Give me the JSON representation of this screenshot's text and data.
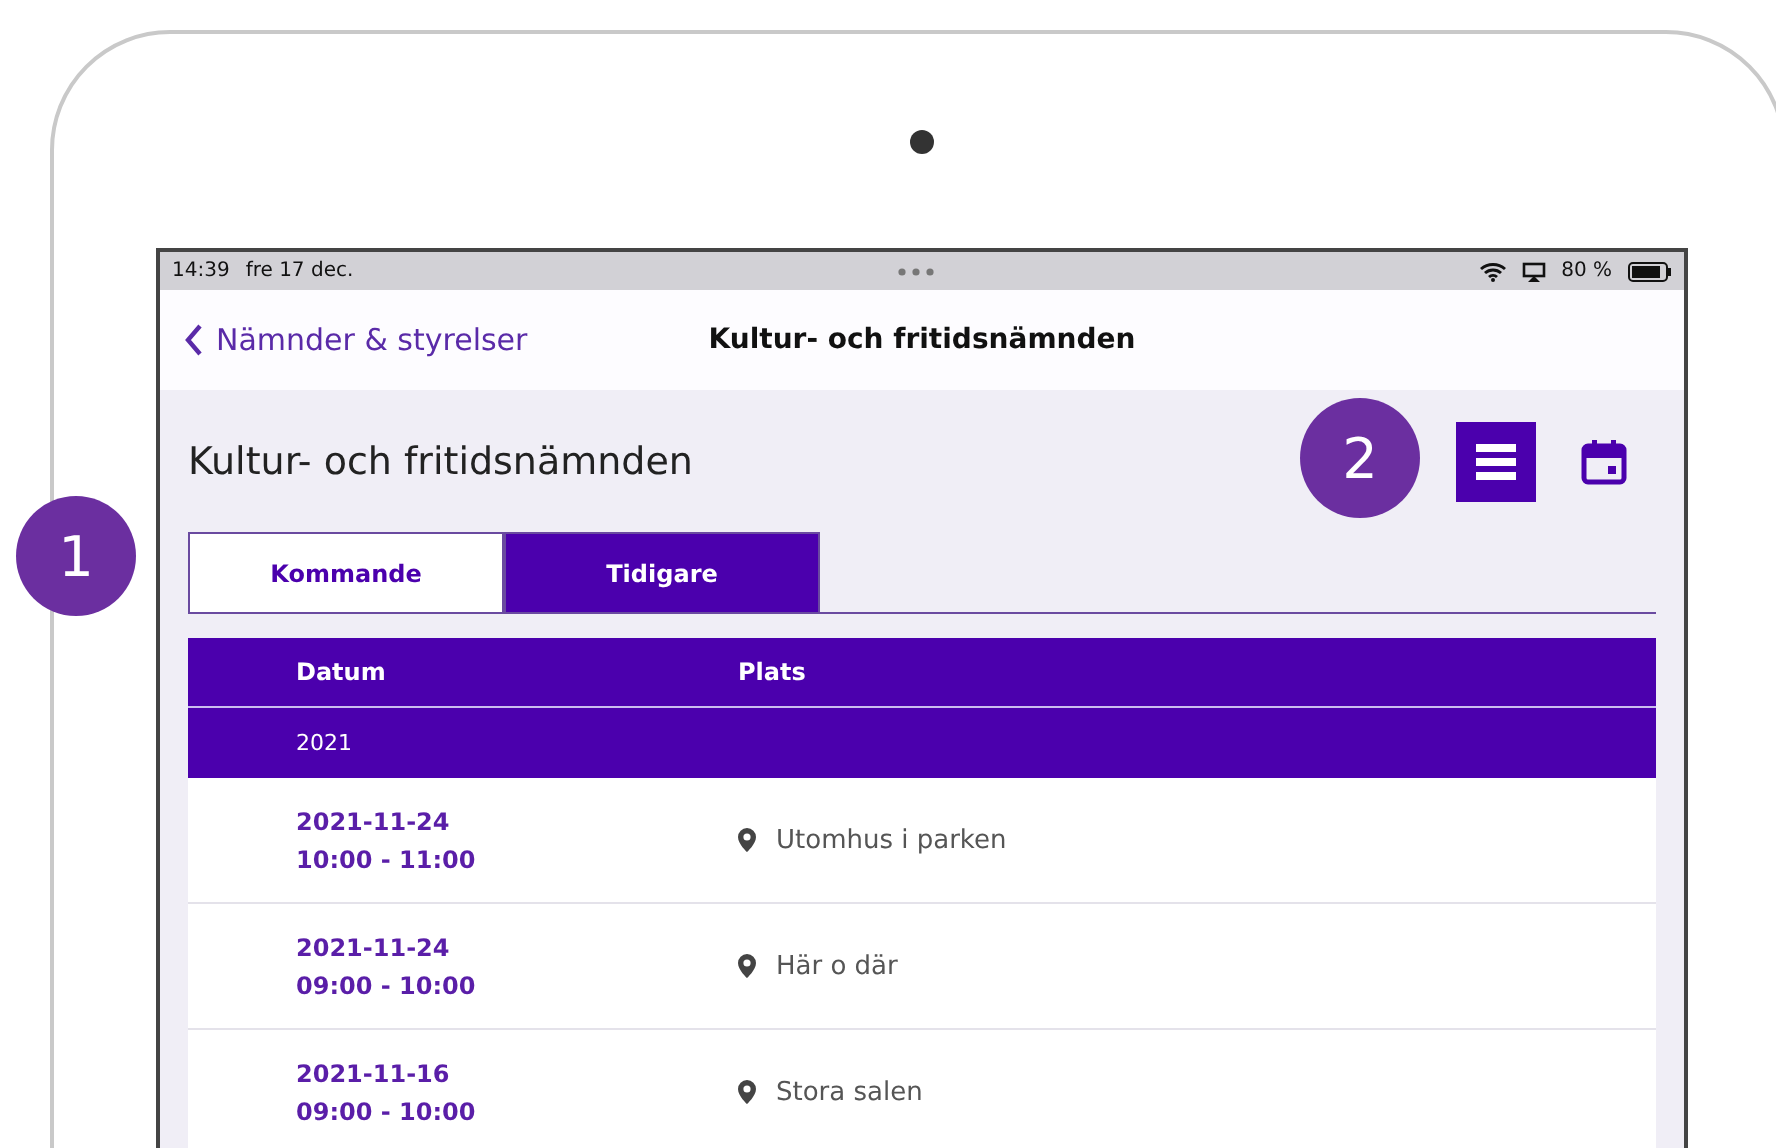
{
  "status_bar": {
    "time": "14:39",
    "date": "fre 17 dec.",
    "battery": "80 %"
  },
  "nav_bar": {
    "back": "Nämnder & styrelser",
    "title": "Kultur- och fritidsnämnden"
  },
  "page_title": "Kultur- och fritidsnämnden",
  "view_toggle": [
    {
      "kind": "list",
      "selected": true
    },
    {
      "kind": "calendar",
      "selected": false
    }
  ],
  "tabs": [
    {
      "label": "Kommande",
      "selected": false
    },
    {
      "label": "Tidigare",
      "selected": true
    }
  ],
  "table": {
    "columns": [
      "Datum",
      "Plats"
    ],
    "group": "2021",
    "rows": [
      {
        "date": "2021-11-24",
        "time": "10:00 - 11:00",
        "place": "Utomhus i parken"
      },
      {
        "date": "2021-11-24",
        "time": "09:00 - 10:00",
        "place": "Här o där"
      },
      {
        "date": "2021-11-16",
        "time": "09:00 - 10:00",
        "place": "Stora salen"
      }
    ]
  },
  "callouts": [
    {
      "number": "1",
      "kind": "tabs"
    },
    {
      "number": "2",
      "kind": "view"
    }
  ]
}
